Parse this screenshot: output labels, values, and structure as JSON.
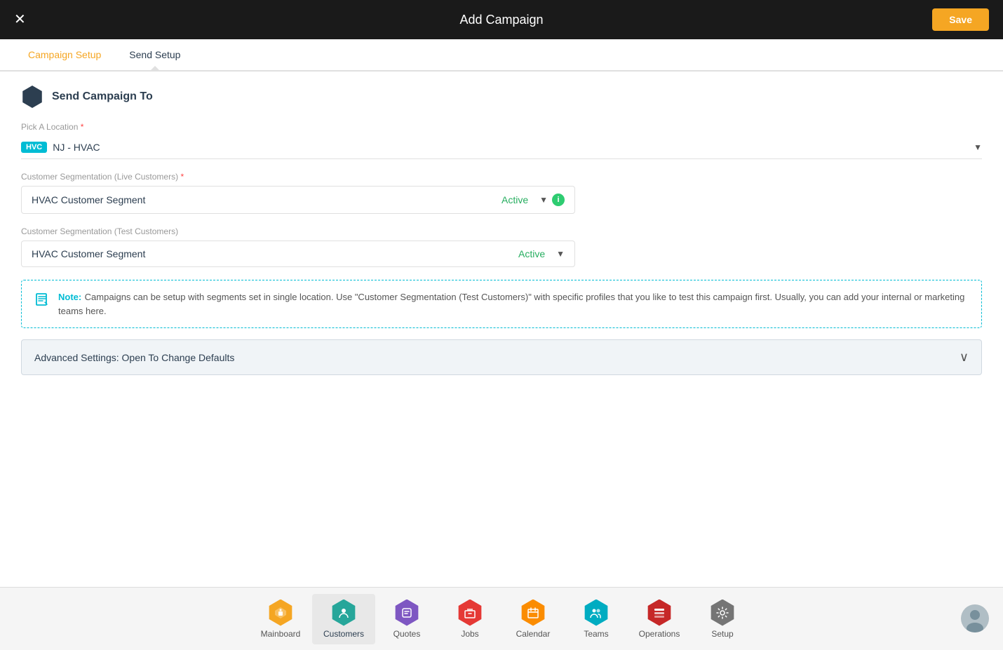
{
  "header": {
    "title": "Add Campaign",
    "close_label": "✕",
    "save_label": "Save"
  },
  "tabs": [
    {
      "id": "campaign-setup",
      "label": "Campaign Setup",
      "active": true,
      "style": "orange"
    },
    {
      "id": "send-setup",
      "label": "Send Setup",
      "active_blue": true
    }
  ],
  "section": {
    "title": "Send Campaign To"
  },
  "location": {
    "label": "Pick A Location",
    "required": true,
    "badge": "HVC",
    "value": "NJ - HVAC"
  },
  "customer_seg_live": {
    "label": "Customer Segmentation (Live Customers)",
    "required": true,
    "value": "HVAC Customer Segment",
    "status": "Active"
  },
  "customer_seg_test": {
    "label": "Customer Segmentation (Test Customers)",
    "value": "HVAC Customer Segment",
    "status": "Active"
  },
  "note": {
    "prefix": "Note:",
    "text": "Campaigns can be setup with segments set in single location. Use \"Customer Segmentation (Test Customers)\" with specific profiles that you like to test this campaign first. Usually, you can add your internal or marketing teams here."
  },
  "advanced_settings": {
    "label": "Advanced Settings: Open To Change Defaults"
  },
  "bottom_nav": {
    "items": [
      {
        "id": "mainboard",
        "label": "Mainboard",
        "color": "hex-yellow",
        "icon": "⬡"
      },
      {
        "id": "customers",
        "label": "Customers",
        "color": "hex-teal",
        "icon": "👤",
        "active": true
      },
      {
        "id": "quotes",
        "label": "Quotes",
        "color": "hex-purple",
        "icon": "💬"
      },
      {
        "id": "jobs",
        "label": "Jobs",
        "color": "hex-red",
        "icon": "🔧"
      },
      {
        "id": "calendar",
        "label": "Calendar",
        "color": "hex-orange",
        "icon": "📅"
      },
      {
        "id": "teams",
        "label": "Teams",
        "color": "hex-cyan",
        "icon": "👥"
      },
      {
        "id": "operations",
        "label": "Operations",
        "color": "hex-darkred",
        "icon": "🗂"
      },
      {
        "id": "setup",
        "label": "Setup",
        "color": "hex-gray",
        "icon": "⚙"
      }
    ]
  }
}
